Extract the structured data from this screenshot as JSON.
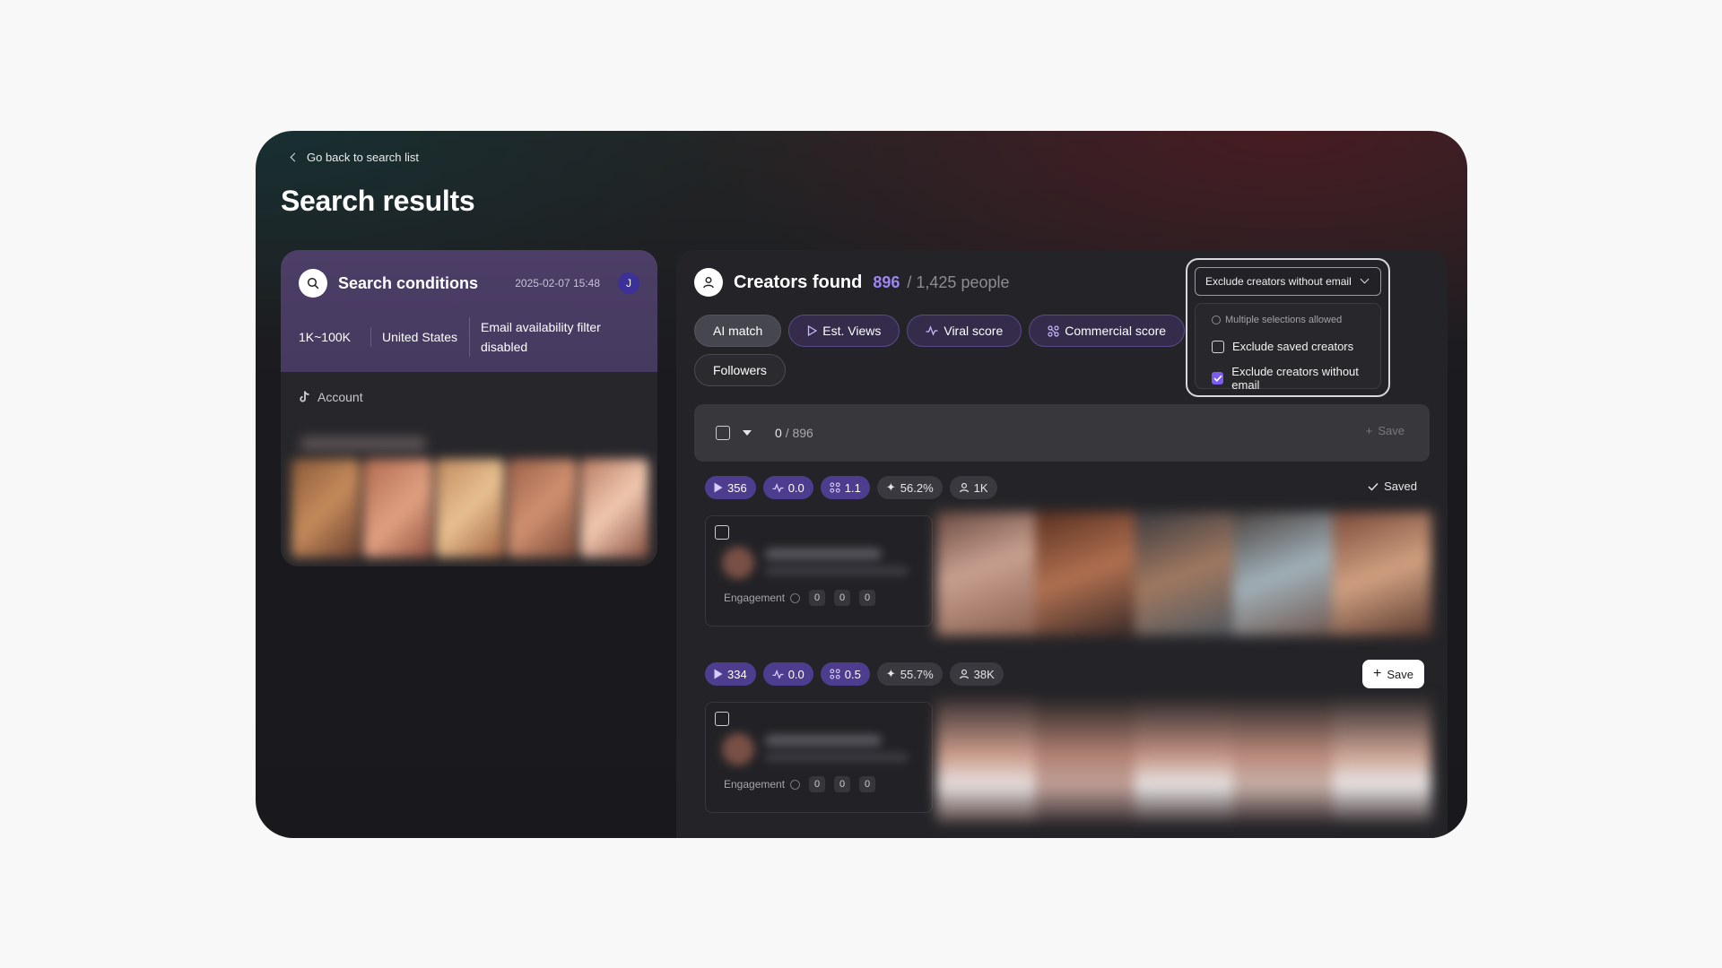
{
  "nav": {
    "back_label": "Go back to search list"
  },
  "page": {
    "title": "Search results"
  },
  "conditions": {
    "title": "Search conditions",
    "date": "2025-02-07 15:48",
    "avatar_initial": "J",
    "followers": "1K~100K",
    "country": "United States",
    "email_filter": "Email availability filter disabled",
    "account_label": "Account"
  },
  "results": {
    "title": "Creators found",
    "found": "896",
    "total": "/ 1,425 people",
    "sort_chips": [
      "AI match",
      "Est. Views",
      "Viral score",
      "Commercial score",
      "Followers"
    ],
    "selected": "0",
    "selected_total": "/ 896",
    "save_label": "Save"
  },
  "dropdown": {
    "trigger": "Exclude creators without email",
    "hint": "Multiple selections allowed",
    "options": [
      {
        "label": "Exclude saved creators",
        "checked": false
      },
      {
        "label": "Exclude creators without email",
        "checked": true
      }
    ]
  },
  "creators": [
    {
      "views": "356",
      "viral": "0.0",
      "commercial": "1.1",
      "rate": "56.2%",
      "followers": "1K",
      "status": "Saved",
      "engagement_label": "Engagement",
      "engagement_values": [
        "0",
        "0",
        "0"
      ]
    },
    {
      "views": "334",
      "viral": "0.0",
      "commercial": "0.5",
      "rate": "55.7%",
      "followers": "38K",
      "status": "Save",
      "engagement_label": "Engagement",
      "engagement_values": [
        "0",
        "0",
        "0"
      ]
    }
  ],
  "colors": {
    "accent": "#9d86ee",
    "purple_badge": "#4e3d8f",
    "checkbox_on": "#7a5cf0"
  }
}
